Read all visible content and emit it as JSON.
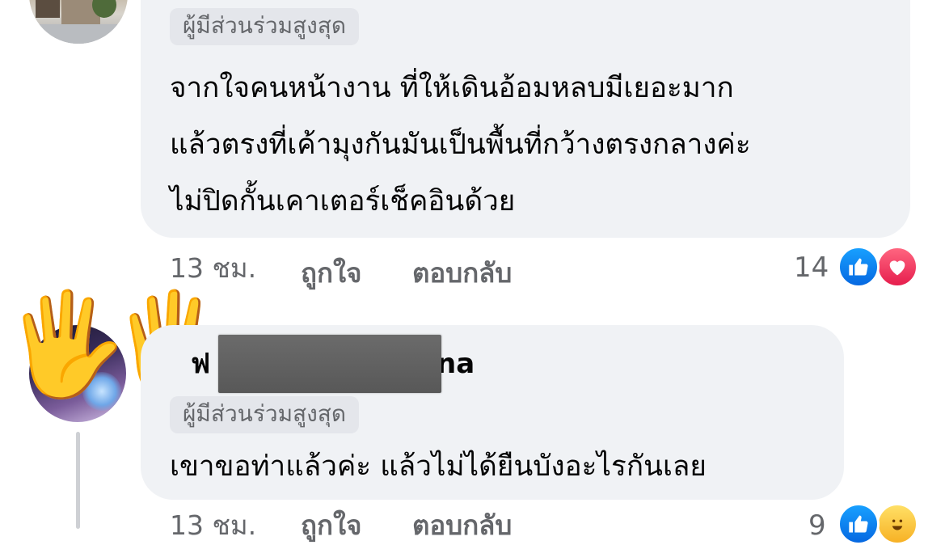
{
  "comments": [
    {
      "badge": "ผู้มีส่วนร่วมสูงสุด",
      "lines": [
        "จากใจคนหน้างาน ที่ให้เดินอ้อมหลบมีเยอะมาก",
        "แล้วตรงที่เค้ามุงกันมันเป็นพื้นที่กว้างตรงกลางค่ะ",
        "ไม่ปิดกั้นเคาเตอร์เช็คอินด้วย"
      ],
      "time": "13 ชม.",
      "like_label": "ถูกใจ",
      "reply_label": "ตอบกลับ",
      "reaction_count": "14",
      "reactions": [
        "like-icon",
        "love-icon"
      ]
    },
    {
      "name_start": "ฟ",
      "name_end": "na",
      "badge": "ผู้มีส่วนร่วมสูงสุด",
      "lines": [
        "เขาขอท่าแล้วค่ะ แล้วไม่ได้ยืนบังอะไรกันเลย"
      ],
      "time": "13 ชม.",
      "like_label": "ถูกใจ",
      "reply_label": "ตอบกลับ",
      "reaction_count": "9",
      "reactions": [
        "like-icon",
        "haha-icon"
      ]
    }
  ],
  "colors": {
    "bubble": "#f0f2f5",
    "badge_bg": "#e4e6eb",
    "meta_text": "#65676b",
    "like": "#0866ff",
    "love": "#f0284a"
  }
}
